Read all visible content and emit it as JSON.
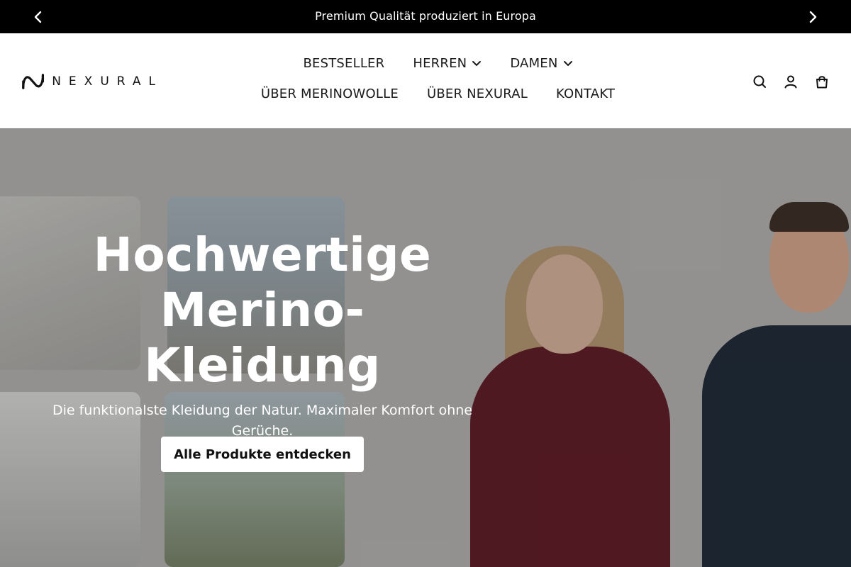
{
  "announcement": {
    "text": "Premium Qualität produziert in Europa",
    "prev_icon": "chevron-left-icon",
    "next_icon": "chevron-right-icon"
  },
  "header": {
    "logo_text": "NEXURAL",
    "nav": [
      {
        "label": "BESTSELLER",
        "has_dropdown": false
      },
      {
        "label": "HERREN",
        "has_dropdown": true
      },
      {
        "label": "DAMEN",
        "has_dropdown": true
      },
      {
        "label": "ÜBER MERINOWOLLE",
        "has_dropdown": false
      },
      {
        "label": "ÜBER NEXURAL",
        "has_dropdown": false
      },
      {
        "label": "KONTAKT",
        "has_dropdown": false
      }
    ],
    "icons": [
      "search-icon",
      "account-icon",
      "cart-icon"
    ]
  },
  "hero": {
    "title": "Hochwertige Merino-Kleidung",
    "subtitle": "Die funktionalste Kleidung der Natur. Maximaler Komfort ohne Gerüche.",
    "cta_label": "Alle Produkte entdecken"
  },
  "colors": {
    "announcement_bg": "#000000",
    "hero_bg": "#a7a6a4",
    "cta_bg": "#ffffff",
    "text_dark": "#111111"
  }
}
